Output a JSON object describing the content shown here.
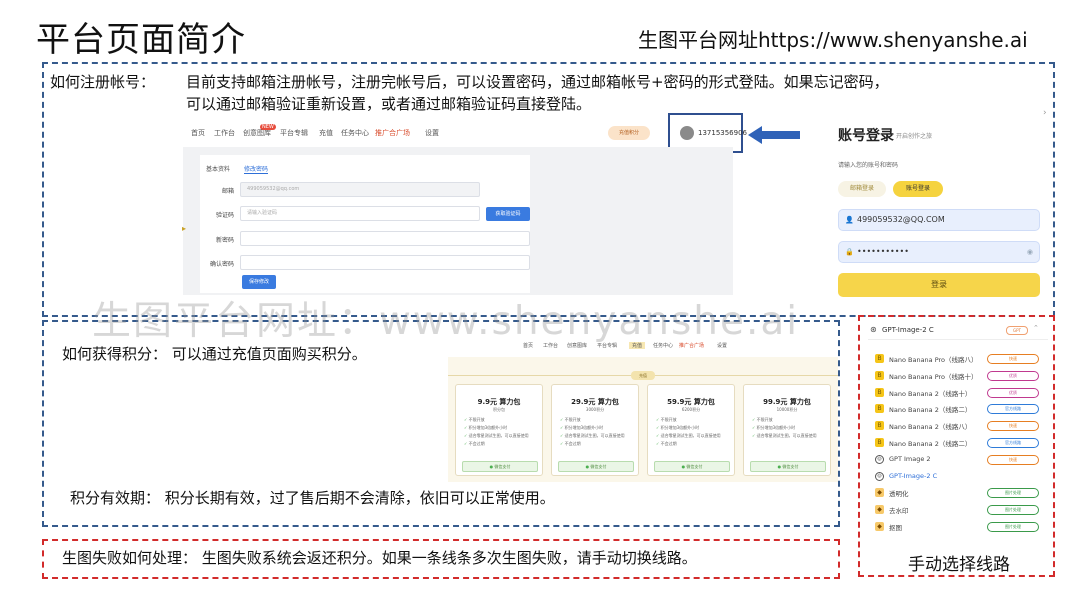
{
  "title": "平台页面简介",
  "site_url": "生图平台网址https://www.shenyanshe.ai",
  "register": {
    "heading": "如何注册帐号：",
    "line1": "目前支持邮箱注册帐号，注册完帐号后，可以设置密码，通过邮箱帐号+密码的形式登陆。如果忘记密码，",
    "line2": "可以通过邮箱验证重新设置，或者通过邮箱验证码直接登陆。",
    "nav": [
      "首页",
      "工作台",
      "创意图库",
      "平台专辑",
      "充值",
      "任务中心",
      "推广合广场",
      "设置"
    ],
    "nav_badge": "NEW",
    "recharge": "充值积分",
    "phone": "13715356906",
    "form": {
      "tab_basic": "基本资料",
      "tab_password": "修改密码",
      "email_label": "邮箱",
      "email_value": "499059532@qq.com",
      "code_label": "验证码",
      "code_placeholder": "请输入验证码",
      "code_button": "获取验证码",
      "new_pwd_label": "新密码",
      "confirm_pwd_label": "确认密码",
      "save_button": "保存修改"
    },
    "login": {
      "title": "账号登录",
      "subtitle": "开启创作之旅",
      "hint": "请输入您的账号和密码",
      "tab_email": "邮箱登录",
      "tab_account": "账号登录",
      "email_value": "499059532@QQ.COM",
      "password_value": "•••••••••••",
      "button": "登录"
    }
  },
  "watermark": "生图平台网址：www.shenyanshe.ai",
  "points": {
    "heading_line": "如何获得积分：  可以通过充值页面购买积分。",
    "validity_line": "积分有效期：  积分长期有效，过了售后期不会清除，依旧可以正常使用。",
    "nav": [
      "首页",
      "工作台",
      "创意图库",
      "平台专辑",
      "充值",
      "任务中心",
      "推广合广场",
      "设置"
    ],
    "pill": "充值",
    "buy_label": "微信支付",
    "packages": [
      {
        "title": "9.9元 算力包",
        "sub": "积分包",
        "features": [
          "不限开放",
          "积分增加3倍额外小时",
          "适合零星测试生图，可以直接使用",
          "不会过期"
        ]
      },
      {
        "title": "29.9元 算力包",
        "sub": "3000积分",
        "features": [
          "不限开放",
          "积分增加3倍额外小时",
          "适合零星测试生图，可以直接使用",
          "不会过期"
        ]
      },
      {
        "title": "59.9元 算力包",
        "sub": "6200积分",
        "features": [
          "不限开放",
          "积分增加3倍额外小时",
          "适合零星测试生图，可以直接使用",
          "不会过期"
        ]
      },
      {
        "title": "99.9元 算力包",
        "sub": "10000积分",
        "features": [
          "不限开放",
          "积分增加3倍额外小时",
          "适合零星测试生图，可以直接使用"
        ]
      }
    ]
  },
  "failure": {
    "line": "生图失败如何处理：  生图失败系统会返还积分。如果一条线条多次生图失败，请手动切换线路。"
  },
  "routes": {
    "current": "GPT-Image-2 C",
    "current_tag": "GPT",
    "caption": "手动选择线路",
    "items": [
      {
        "icon": "banana",
        "name": "Nano Banana Pro（线路八）",
        "tag": "快速",
        "color": "#e67e22",
        "selected": false
      },
      {
        "icon": "banana",
        "name": "Nano Banana Pro（线路十）",
        "tag": "优质",
        "color": "#c0398f",
        "selected": false
      },
      {
        "icon": "banana",
        "name": "Nano Banana 2（线路十）",
        "tag": "优质",
        "color": "#c0398f",
        "selected": false
      },
      {
        "icon": "banana",
        "name": "Nano Banana 2（线路二）",
        "tag": "官方线路",
        "color": "#2e7bd8",
        "selected": false
      },
      {
        "icon": "banana",
        "name": "Nano Banana 2（线路八）",
        "tag": "快速",
        "color": "#e67e22",
        "selected": false
      },
      {
        "icon": "banana",
        "name": "Nano Banana 2（线路二）",
        "tag": "官方线路",
        "color": "#2e7bd8",
        "selected": false
      },
      {
        "icon": "gpt",
        "name": "GPT Image 2",
        "tag": "快速",
        "color": "#e67e22",
        "selected": false
      },
      {
        "icon": "gpt",
        "name": "GPT-Image-2 C",
        "tag": "",
        "color": "#2e7bd8",
        "selected": true
      },
      {
        "icon": "tool",
        "name": "透明化",
        "tag": "图片处理",
        "color": "#3a9a4a",
        "selected": false
      },
      {
        "icon": "tool",
        "name": "去水印",
        "tag": "图片处理",
        "color": "#3a9a4a",
        "selected": false
      },
      {
        "icon": "tool",
        "name": "抠图",
        "tag": "图片处理",
        "color": "#3a9a4a",
        "selected": false
      }
    ]
  }
}
